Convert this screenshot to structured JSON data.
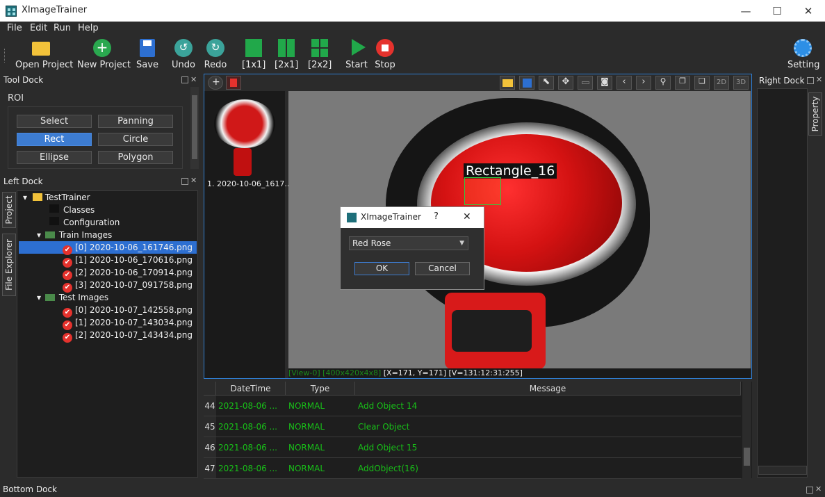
{
  "window": {
    "title": "XImageTrainer",
    "min": "—",
    "max": "☐",
    "close": "✕"
  },
  "menu": [
    "File",
    "Edit",
    "Run",
    "Help"
  ],
  "toolbar": {
    "open": "Open Project",
    "new": "New Project",
    "save": "Save",
    "undo": "Undo",
    "redo": "Redo",
    "g11": "[1x1]",
    "g21": "[2x1]",
    "g22": "[2x2]",
    "start": "Start",
    "stop": "Stop",
    "setting": "Setting"
  },
  "tool_dock": {
    "title": "Tool Dock",
    "group": "ROI",
    "buttons": [
      "Select",
      "Panning",
      "Rect",
      "Circle",
      "Ellipse",
      "Polygon"
    ],
    "active": "Rect"
  },
  "left_dock": {
    "title": "Left Dock",
    "tabs": [
      "Project",
      "File Explorer"
    ],
    "tree": {
      "root": "TestTrainer",
      "classes": "Classes",
      "config": "Configuration",
      "train": "Train Images",
      "train_items": [
        "[0] 2020-10-06_161746.png",
        "[1] 2020-10-06_170616.png",
        "[2] 2020-10-06_170914.png",
        "[3] 2020-10-07_091758.png"
      ],
      "test": "Test Images",
      "test_items": [
        "[0] 2020-10-07_142558.png",
        "[1] 2020-10-07_143034.png",
        "[2] 2020-10-07_143434.png"
      ]
    }
  },
  "viewer": {
    "thumb_label": "1. 2020-10-06_1617...",
    "roi_label": "Rectangle_16",
    "status_green": "[View-0] [400x420x4x8]",
    "status_white": " [X=171, Y=171]  [V=131:12:31:255]",
    "btn_2d": "2D",
    "btn_3d": "3D"
  },
  "dialog": {
    "title": "XImageTrainer",
    "help": "?",
    "close": "✕",
    "selected": "Red Rose",
    "ok": "OK",
    "cancel": "Cancel"
  },
  "log": {
    "headers": [
      "DateTime",
      "Type",
      "Message"
    ],
    "rows": [
      {
        "n": "44",
        "date": "2021-08-06 ...",
        "type": "NORMAL",
        "msg": "Add Object 14"
      },
      {
        "n": "45",
        "date": "2021-08-06 ...",
        "type": "NORMAL",
        "msg": "Clear Object"
      },
      {
        "n": "46",
        "date": "2021-08-06 ...",
        "type": "NORMAL",
        "msg": "Add Object 15"
      },
      {
        "n": "47",
        "date": "2021-08-06 ...",
        "type": "NORMAL",
        "msg": "AddObject(16)"
      }
    ]
  },
  "right_dock": {
    "title": "Right Dock",
    "tab": "Property"
  },
  "bottom_dock": {
    "title": "Bottom Dock"
  },
  "colors": {
    "accent": "#2f7dd0",
    "selection": "#2d6fd1",
    "log_green": "#18c018",
    "check_red": "#e5322d"
  }
}
